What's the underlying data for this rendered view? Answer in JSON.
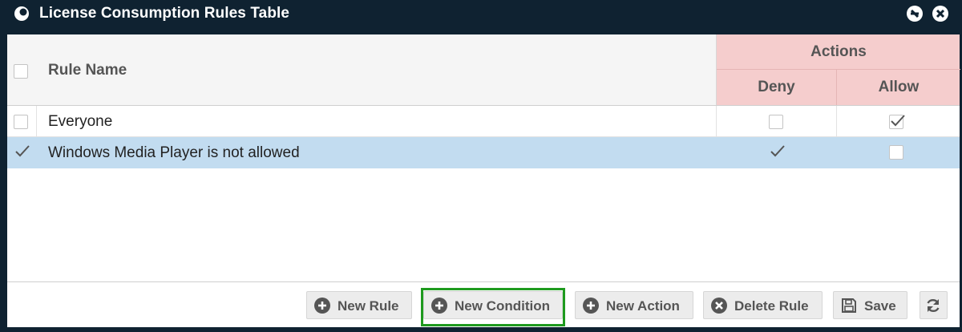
{
  "window": {
    "title": "License Consumption Rules Table"
  },
  "table": {
    "columns": {
      "rule_name": "Rule Name",
      "actions_group": "Actions",
      "deny": "Deny",
      "allow": "Allow"
    },
    "rows": [
      {
        "name": "Everyone",
        "selected": false,
        "deny": false,
        "allow": true
      },
      {
        "name": "Windows Media Player is not allowed",
        "selected": true,
        "deny": true,
        "allow": false
      }
    ]
  },
  "toolbar": {
    "new_rule": "New Rule",
    "new_condition": "New Condition",
    "new_action": "New Action",
    "delete_rule": "Delete Rule",
    "save": "Save"
  },
  "colors": {
    "titlebar_bg": "#0f2231",
    "actions_header_bg": "#f5cdcd",
    "selected_row_bg": "#c2dcf0",
    "highlight_border": "#1e9a1e"
  }
}
